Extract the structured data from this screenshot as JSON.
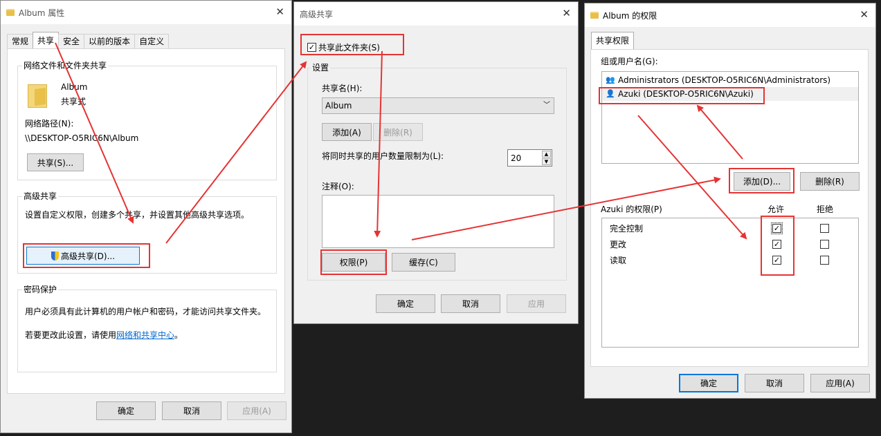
{
  "win1": {
    "title": "Album 属性",
    "tabs": [
      "常规",
      "共享",
      "安全",
      "以前的版本",
      "自定义"
    ],
    "share_group": "网络文件和文件夹共享",
    "folder_name": "Album",
    "share_state": "共享式",
    "path_label": "网络路径(N):",
    "path_value": "\\\\DESKTOP-O5RIC6N\\Album",
    "share_btn": "共享(S)...",
    "adv_group": "高级共享",
    "adv_desc": "设置自定义权限，创建多个共享，并设置其他高级共享选项。",
    "adv_btn": "高级共享(D)...",
    "pwd_group": "密码保护",
    "pwd_desc": "用户必须具有此计算机的用户帐户和密码，才能访问共享文件夹。",
    "pwd_change_prefix": "若要更改此设置，请使用",
    "pwd_link": "网络和共享中心",
    "pwd_change_suffix": "。",
    "ok": "确定",
    "cancel": "取消",
    "apply": "应用(A)"
  },
  "win2": {
    "title": "高级共享",
    "share_check": "共享此文件夹(S)",
    "settings_group": "设置",
    "share_name_label": "共享名(H):",
    "share_name_value": "Album",
    "add_btn": "添加(A)",
    "remove_btn": "删除(R)",
    "limit_label": "将同时共享的用户数量限制为(L):",
    "limit_value": "20",
    "comment_label": "注释(O):",
    "perm_btn": "权限(P)",
    "cache_btn": "缓存(C)",
    "ok": "确定",
    "cancel": "取消",
    "apply": "应用"
  },
  "win3": {
    "title": "Album 的权限",
    "tab": "共享权限",
    "group_label": "组或用户名(G):",
    "users": [
      "Administrators (DESKTOP-O5RIC6N\\Administrators)",
      "Azuki (DESKTOP-O5RIC6N\\Azuki)"
    ],
    "add_btn": "添加(D)...",
    "remove_btn": "删除(R)",
    "perm_label": "Azuki 的权限(P)",
    "allow": "允许",
    "deny": "拒绝",
    "perms": [
      {
        "name": "完全控制",
        "allow": true,
        "deny": false
      },
      {
        "name": "更改",
        "allow": true,
        "deny": false
      },
      {
        "name": "读取",
        "allow": true,
        "deny": false
      }
    ],
    "ok": "确定",
    "cancel": "取消",
    "apply": "应用(A)"
  },
  "colors": {
    "highlight": "#e53333",
    "accent": "#0078d7",
    "link": "#0066cc"
  }
}
